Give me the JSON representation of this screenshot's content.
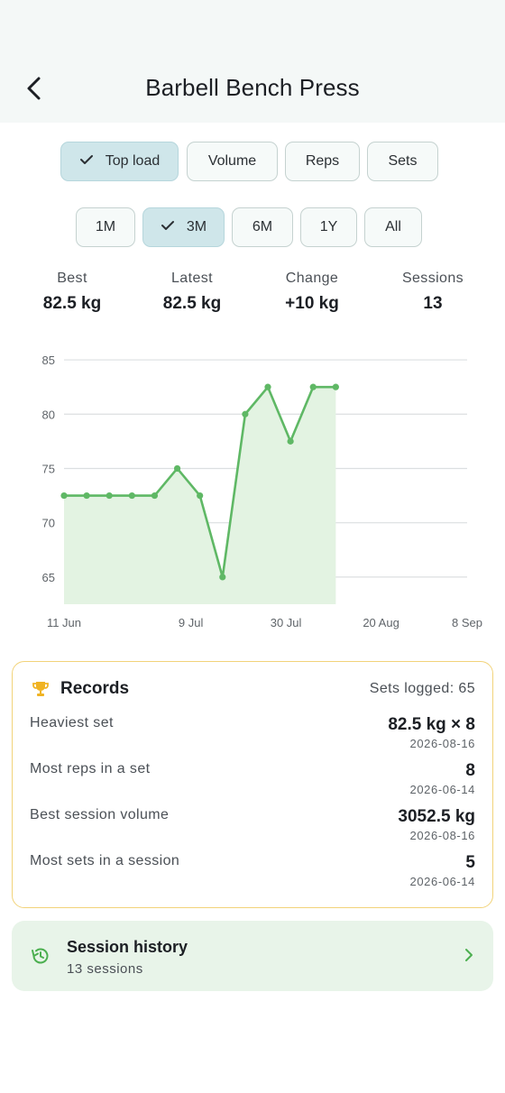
{
  "header": {
    "title": "Barbell Bench Press",
    "back_icon": "chevron-left-icon"
  },
  "metric_tabs": [
    {
      "label": "Top load",
      "selected": true
    },
    {
      "label": "Volume",
      "selected": false
    },
    {
      "label": "Reps",
      "selected": false
    },
    {
      "label": "Sets",
      "selected": false
    }
  ],
  "range_tabs": [
    {
      "label": "1M",
      "selected": false
    },
    {
      "label": "3M",
      "selected": true
    },
    {
      "label": "6M",
      "selected": false
    },
    {
      "label": "1Y",
      "selected": false
    },
    {
      "label": "All",
      "selected": false
    }
  ],
  "stats": [
    {
      "label": "Best",
      "value": "82.5 kg"
    },
    {
      "label": "Latest",
      "value": "82.5 kg"
    },
    {
      "label": "Change",
      "value": "+10 kg"
    },
    {
      "label": "Sessions",
      "value": "13"
    }
  ],
  "chart_data": {
    "type": "area",
    "title": "",
    "xlabel": "",
    "ylabel": "",
    "x": [
      "2026-06-11",
      "2026-06-16",
      "2026-06-21",
      "2026-06-26",
      "2026-07-01",
      "2026-07-06",
      "2026-07-11",
      "2026-07-16",
      "2026-07-21",
      "2026-07-26",
      "2026-07-31",
      "2026-08-05",
      "2026-08-10"
    ],
    "series": [
      {
        "values": [
          72.5,
          72.5,
          72.5,
          72.5,
          72.5,
          75,
          72.5,
          65,
          80,
          82.5,
          77.5,
          82.5,
          82.5
        ]
      }
    ],
    "x_ticks": [
      {
        "date": "2026-06-11",
        "label": "11 Jun"
      },
      {
        "date": "2026-07-09",
        "label": "9 Jul"
      },
      {
        "date": "2026-07-30",
        "label": "30 Jul"
      },
      {
        "date": "2026-08-20",
        "label": "20 Aug"
      },
      {
        "date": "2026-09-08",
        "label": "8 Sep"
      }
    ],
    "y_ticks": [
      65,
      70,
      75,
      80,
      85
    ],
    "ylim": [
      62.5,
      86
    ],
    "x_range": [
      "2026-06-11",
      "2026-09-08"
    ],
    "grid": true,
    "line_color": "#5fb865",
    "fill_color": "#e3f3e2"
  },
  "records": {
    "title": "Records",
    "icon": "trophy-icon",
    "sets_logged": "Sets logged: 65",
    "items": [
      {
        "label": "Heaviest set",
        "value": "82.5 kg × 8",
        "date": "2026-08-16"
      },
      {
        "label": "Most reps in a set",
        "value": "8",
        "date": "2026-06-14"
      },
      {
        "label": "Best session volume",
        "value": "3052.5 kg",
        "date": "2026-08-16"
      },
      {
        "label": "Most sets in a session",
        "value": "5",
        "date": "2026-06-14"
      }
    ]
  },
  "history": {
    "title": "Session history",
    "subtitle": "13 sessions",
    "icon": "history-icon",
    "chevron_icon": "chevron-right-icon"
  },
  "colors": {
    "accent": "#5fb865",
    "selected_chip": "#cfe6ea",
    "records_border": "#f2d37a",
    "history_bg": "#e8f4e9"
  }
}
